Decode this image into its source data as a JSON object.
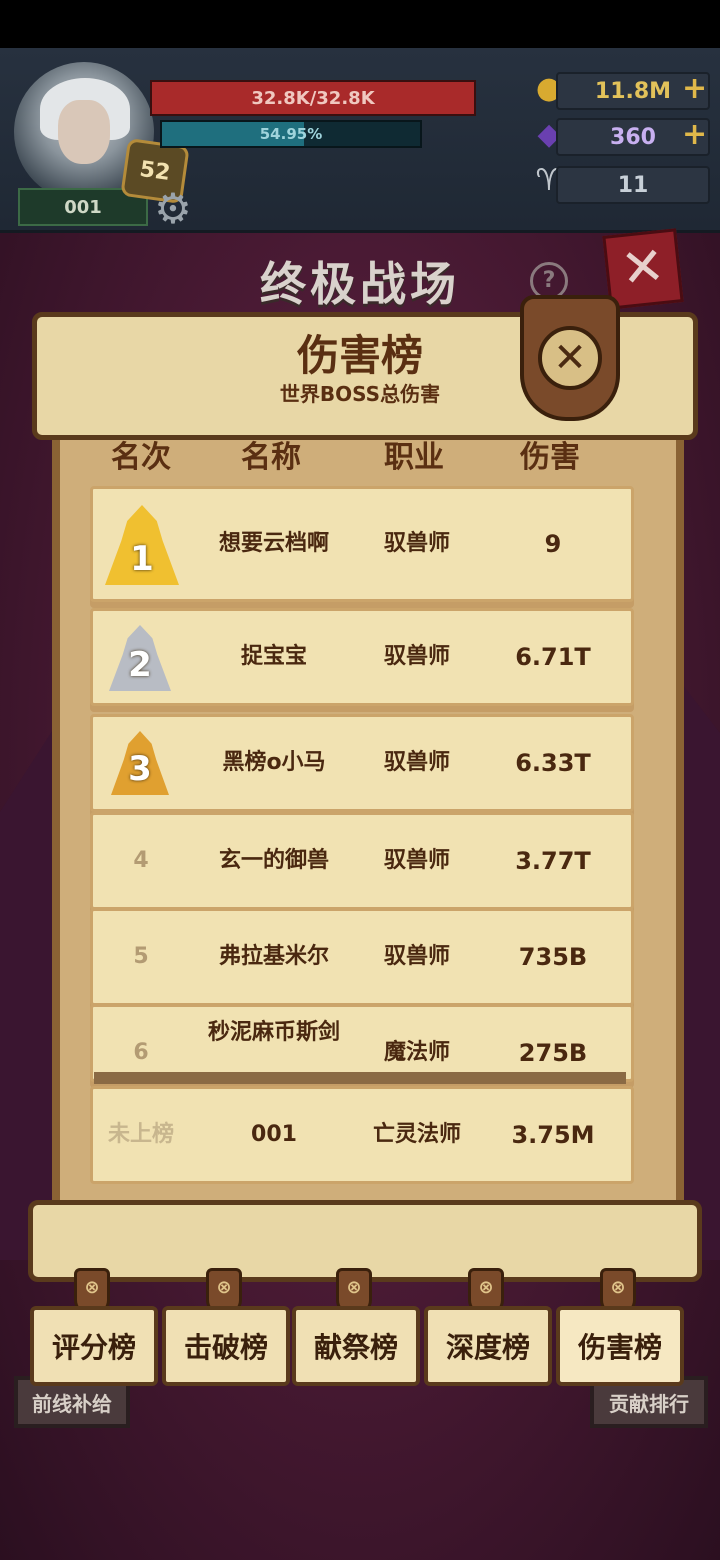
{
  "hud": {
    "player_id": "001",
    "level": "52",
    "hp_text": "32.8K/32.8K",
    "hp_fraction": 1.0,
    "xp_text": "54.95%",
    "xp_fraction": 0.5495,
    "gold": "11.8M",
    "gems": "360",
    "keys": "11",
    "plus_symbol": "+"
  },
  "icons": {
    "gear": "⚙",
    "help": "?",
    "close": "✕",
    "gold": "coin-icon",
    "gem": "gem-icon",
    "ram": "ram-skull-icon"
  },
  "page": {
    "title": "终极战场"
  },
  "panel": {
    "title": "伤害榜",
    "subtitle": "世界BOSS总伤害",
    "headers": [
      "名次",
      "名称",
      "职业",
      "伤害"
    ]
  },
  "rows": [
    {
      "rank": "1",
      "name": "想要云档啊",
      "job": "驭兽师",
      "damage": "9"
    },
    {
      "rank": "2",
      "name": "捉宝宝",
      "job": "驭兽师",
      "damage": "6.71T"
    },
    {
      "rank": "3",
      "name": "黑榜o小马",
      "job": "驭兽师",
      "damage": "6.33T"
    },
    {
      "rank": "4",
      "name": "玄一的御兽",
      "job": "驭兽师",
      "damage": "3.77T"
    },
    {
      "rank": "5",
      "name": "弗拉基米尔",
      "job": "驭兽师",
      "damage": "735B"
    },
    {
      "rank": "6",
      "name": "秒泥麻币斯剑",
      "job": "魔法师",
      "damage": "275B"
    }
  ],
  "my_entry": {
    "rank": "未上榜",
    "name": "001",
    "job": "亡灵法师",
    "damage": "3.75M"
  },
  "tabs": [
    "评分榜",
    "击破榜",
    "献祭榜",
    "深度榜",
    "伤害榜"
  ],
  "side_buttons": {
    "left": "前线补给",
    "right": "贡献排行"
  },
  "colors": {
    "gold_medal": "#f0c030",
    "silver_medal": "#b8bcc4",
    "bronze_medal": "#e0a030",
    "parchment": "#f1e2b2",
    "ink": "#4a2810"
  }
}
